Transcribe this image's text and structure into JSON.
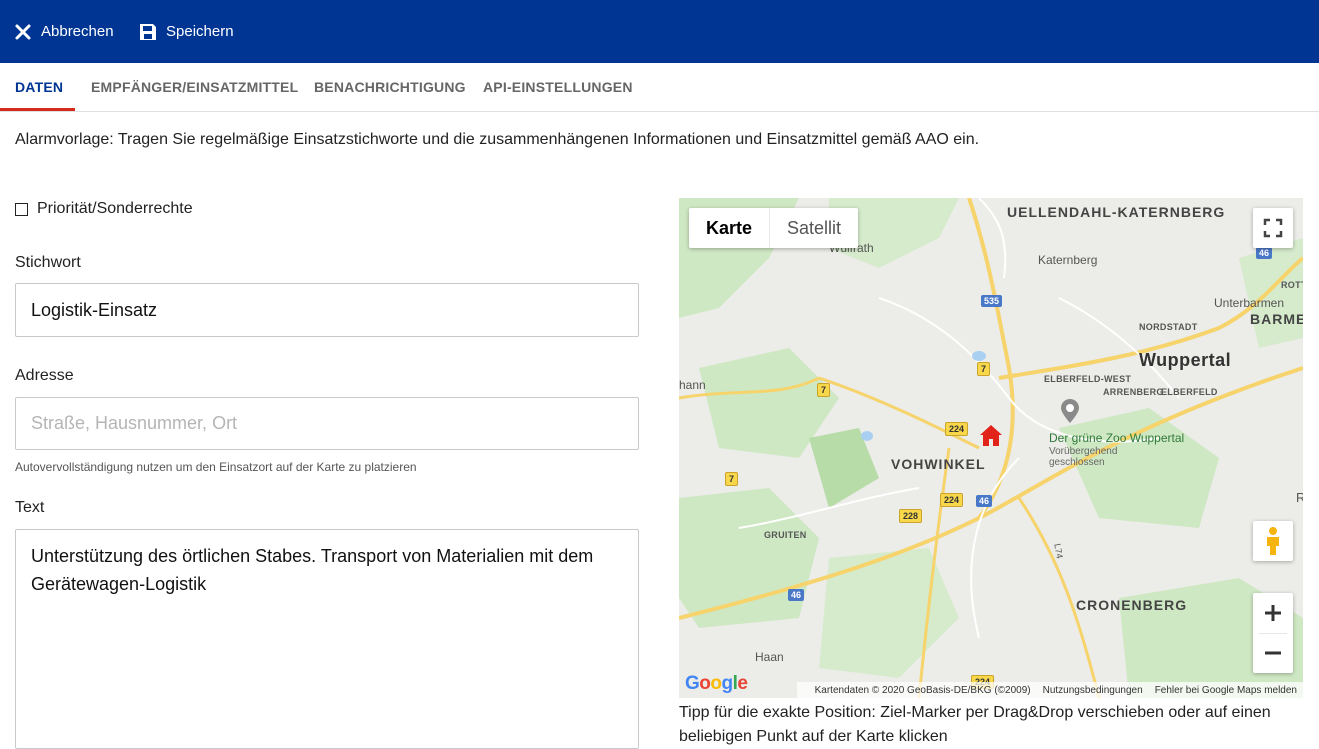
{
  "toolbar": {
    "cancel_label": "Abbrechen",
    "save_label": "Speichern",
    "background": "#003594"
  },
  "tabs": [
    {
      "label": "DATEN",
      "active": true
    },
    {
      "label": "EMPFÄNGER/EINSATZMITTEL",
      "active": false
    },
    {
      "label": "BENACHRICHTIGUNG",
      "active": false
    },
    {
      "label": "API-EINSTELLUNGEN",
      "active": false
    }
  ],
  "intro_text": "Alarmvorlage: Tragen Sie regelmäßige Einsatzstichworte und die zusammenhängenen Informationen und Einsatzmittel gemäß AAO ein.",
  "form": {
    "priority_label": "Priorität/Sonderrechte",
    "priority_checked": false,
    "keyword_label": "Stichwort",
    "keyword_value": "Logistik-Einsatz",
    "address_label": "Adresse",
    "address_placeholder": "Straße, Hausnummer, Ort",
    "address_value": "",
    "address_hint": "Autovervollständigung nutzen um den Einsatzort auf der Karte zu platzieren",
    "text_label": "Text",
    "text_value": "Unterstützung des örtlichen Stabes. Transport von Materialien mit dem Gerätewagen-Logistik"
  },
  "map": {
    "type_map": "Karte",
    "type_satellite": "Satellit",
    "active_type": "Karte",
    "labels": {
      "uellendahl": "UELLENDAHL-KATERNBERG",
      "katernberg": "Katernberg",
      "unterbarmen": "Unterbarmen",
      "nordstadt": "NORDSTADT",
      "barmen": "BARME",
      "wuppertal": "Wuppertal",
      "elberfeld_west": "ELBERFELD-WEST",
      "arrenberg": "ARRENBERG",
      "elberfeld": "ELBERFELD",
      "zoo": "Der grüne Zoo Wuppertal",
      "zoo_note1": "Vorübergehend",
      "zoo_note2": "geschlossen",
      "vohwinkel": "VOHWINKEL",
      "gruiten": "GRUITEN",
      "cronenberg": "CRONENBERG",
      "haan": "Haan",
      "wulfrath": "Wülfrath",
      "hann": "hann",
      "rott": "ROTT",
      "r": "R"
    },
    "shields": [
      "535",
      "46",
      "7",
      "7",
      "224",
      "224",
      "46",
      "228",
      "7",
      "46",
      "224",
      "L74"
    ],
    "attribution": "Kartendaten © 2020 GeoBasis-DE/BKG (©2009)",
    "terms": "Nutzungsbedingungen",
    "report": "Fehler bei Google Maps melden",
    "logo": "Google"
  },
  "tip_text": "Tipp für die exakte Position: Ziel-Marker per Drag&Drop verschieben oder auf einen beliebigen Punkt auf der Karte klicken"
}
